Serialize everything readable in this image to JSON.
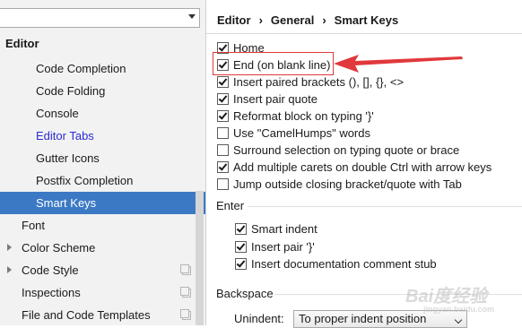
{
  "sidebar": {
    "search_value": "",
    "items": [
      {
        "label": "Editor"
      },
      {
        "label": "Code Completion"
      },
      {
        "label": "Code Folding"
      },
      {
        "label": "Console"
      },
      {
        "label": "Editor Tabs"
      },
      {
        "label": "Gutter Icons"
      },
      {
        "label": "Postfix Completion"
      },
      {
        "label": "Smart Keys"
      },
      {
        "label": "Font"
      },
      {
        "label": "Color Scheme"
      },
      {
        "label": "Code Style"
      },
      {
        "label": "Inspections"
      },
      {
        "label": "File and Code Templates"
      }
    ]
  },
  "breadcrumb": {
    "parts": [
      "Editor",
      "General",
      "Smart Keys"
    ],
    "separator": "›"
  },
  "options": [
    {
      "label": "Home",
      "checked": true
    },
    {
      "label": "End (on blank line)",
      "checked": true
    },
    {
      "label": "Insert paired brackets (), [], {}, <>",
      "checked": true
    },
    {
      "label": "Insert pair quote",
      "checked": true
    },
    {
      "label": "Reformat block on typing '}'",
      "checked": true
    },
    {
      "label": "Use \"CamelHumps\" words",
      "checked": false
    },
    {
      "label": "Surround selection on typing quote or brace",
      "checked": false
    },
    {
      "label": "Add multiple carets on double Ctrl with arrow keys",
      "checked": true
    },
    {
      "label": "Jump outside closing bracket/quote with Tab",
      "checked": false
    }
  ],
  "enter": {
    "title": "Enter",
    "options": [
      {
        "label": "Smart indent",
        "checked": true
      },
      {
        "label": "Insert pair '}'",
        "checked": true
      },
      {
        "label": "Insert documentation comment stub",
        "checked": true
      }
    ]
  },
  "backspace": {
    "title": "Backspace",
    "unindent_label": "Unindent:",
    "unindent_value": "To proper indent position"
  },
  "watermark": {
    "text": "Bai度经验",
    "sub": "jingyan.baidu.com"
  },
  "colors": {
    "selection": "#3c79c4",
    "link": "#2b2bd8",
    "annotation": "#e0383c"
  }
}
